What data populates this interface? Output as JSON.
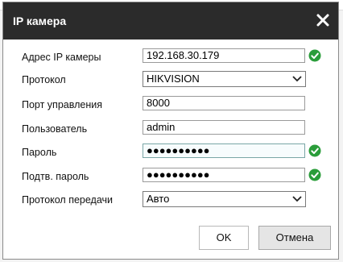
{
  "dialog": {
    "title": "IP камера",
    "close_icon": "close-icon"
  },
  "form": {
    "ip": {
      "label": "Адрес IP камеры",
      "value": "192.168.30.179",
      "valid": true
    },
    "protocol": {
      "label": "Протокол",
      "value": "HIKVISION"
    },
    "port": {
      "label": "Порт управления",
      "value": "8000"
    },
    "user": {
      "label": "Пользователь",
      "value": "admin"
    },
    "password": {
      "label": "Пароль",
      "value": "●●●●●●●●●●",
      "valid": true
    },
    "password_confirm": {
      "label": "Подтв. пароль",
      "value": "●●●●●●●●●●",
      "valid": true
    },
    "transport": {
      "label": "Протокол передачи",
      "value": "Авто"
    }
  },
  "buttons": {
    "ok": "OK",
    "cancel": "Отмена"
  },
  "colors": {
    "titlebar": "#2b2b2b",
    "check": "#2a9d3a"
  }
}
